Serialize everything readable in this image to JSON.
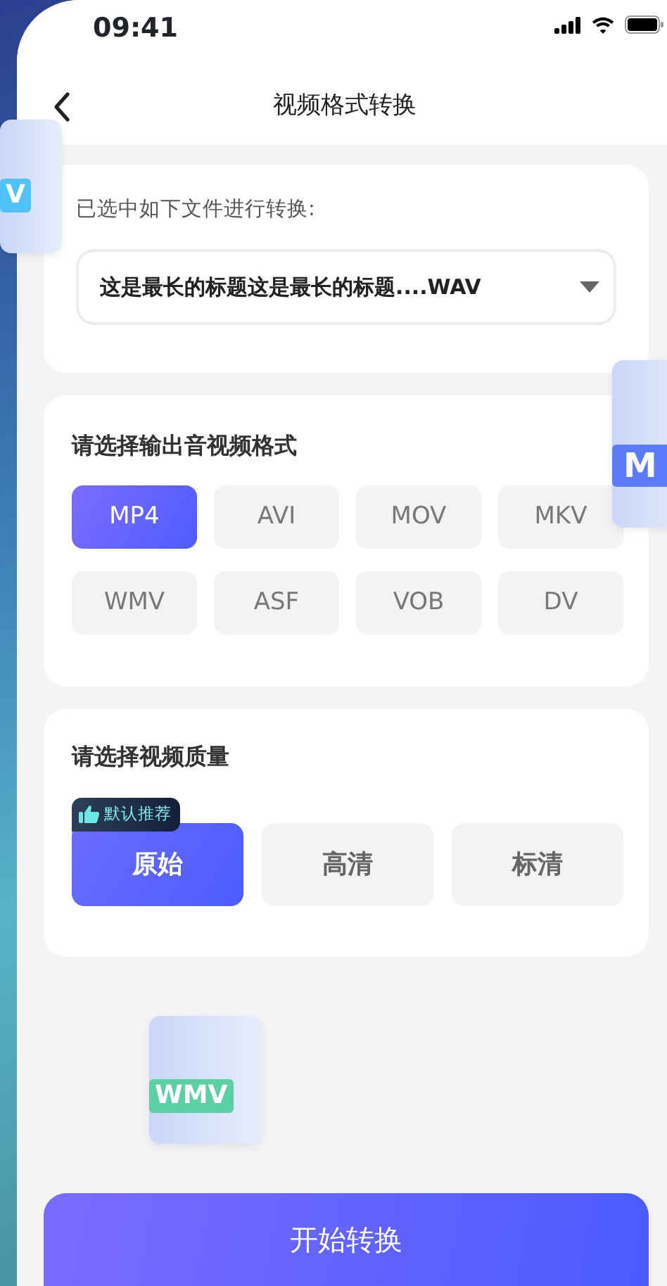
{
  "status_bar": {
    "time": "09:41"
  },
  "nav": {
    "title": "视频格式转换"
  },
  "source": {
    "label": "已选中如下文件进行转换:",
    "selected_file": "这是最长的标题这是最长的标题....WAV"
  },
  "formats": {
    "title": "请选择输出音视频格式",
    "items": [
      {
        "label": "MP4",
        "selected": true
      },
      {
        "label": "AVI",
        "selected": false
      },
      {
        "label": "MOV",
        "selected": false
      },
      {
        "label": "MKV",
        "selected": false
      },
      {
        "label": "WMV",
        "selected": false
      },
      {
        "label": "ASF",
        "selected": false
      },
      {
        "label": "VOB",
        "selected": false
      },
      {
        "label": "DV",
        "selected": false
      }
    ]
  },
  "quality": {
    "title": "请选择视频质量",
    "badge": "默认推荐",
    "items": [
      {
        "label": "原始",
        "selected": true
      },
      {
        "label": "高清",
        "selected": false
      },
      {
        "label": "标清",
        "selected": false
      }
    ]
  },
  "floating_files": [
    {
      "tag": "V",
      "color": "#4fc3f7"
    },
    {
      "tag": "M",
      "color": "#5b7cff"
    },
    {
      "tag": "WMV",
      "color": "#5ccfa5"
    }
  ],
  "start_button": "开始转换"
}
